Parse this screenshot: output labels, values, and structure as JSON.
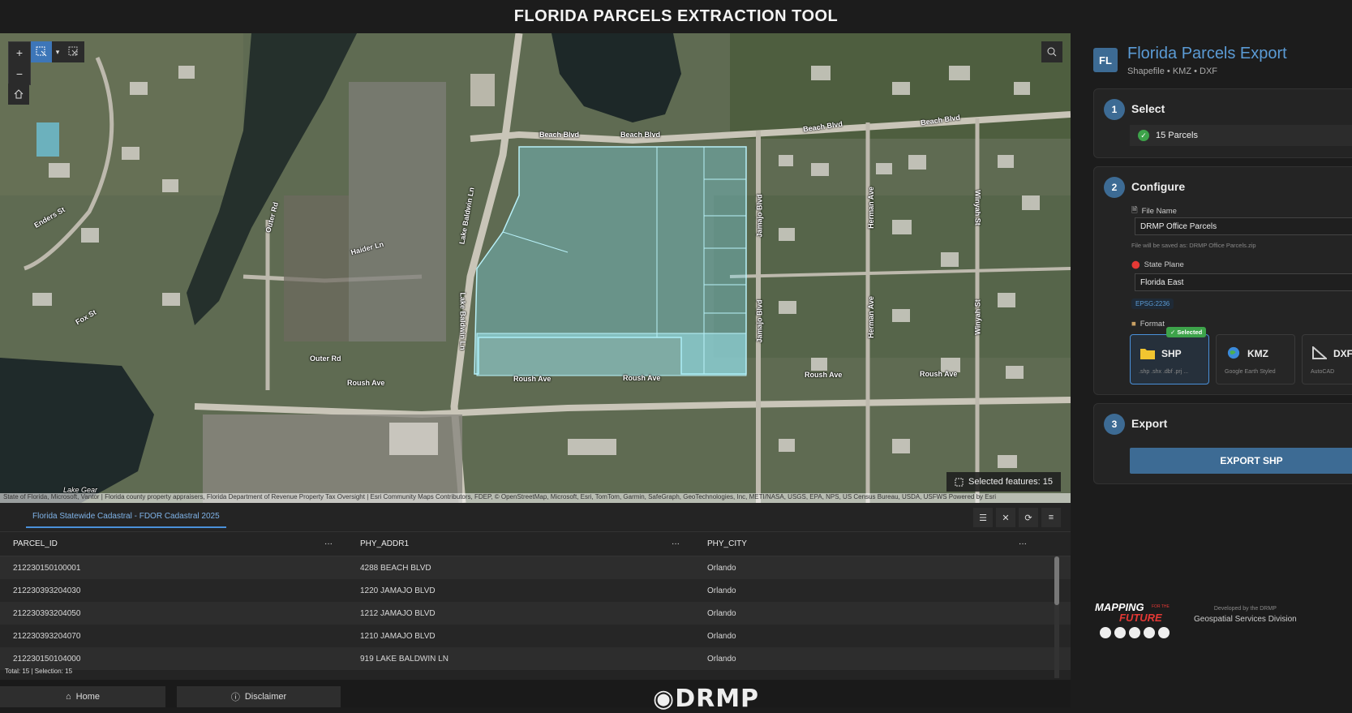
{
  "app": {
    "title": "FLORIDA PARCELS EXTRACTION TOOL"
  },
  "map": {
    "zoom_in": "+",
    "zoom_out": "−",
    "selected_label": "Selected features: 15",
    "attribution": "State of Florida, Microsoft, Vantor | Florida county property appraisers, Florida Department of Revenue Property Tax Oversight | Esri Community Maps Contributors, FDEP, © OpenStreetMap, Microsoft, Esri, TomTom, Garmin, SafeGraph, GeoTechnologies, Inc, METI/NASA, USGS, EPA, NPS, US Census Bureau, USDA, USFWS",
    "powered_by": "Powered by Esri",
    "street_labels": {
      "beach_blvd_1": "Beach Blvd",
      "beach_blvd_2": "Beach Blvd",
      "beach_blvd_3": "Beach Blvd",
      "beach_blvd_4": "Beach Blvd",
      "roush_ave_1": "Roush Ave",
      "roush_ave_2": "Roush Ave",
      "roush_ave_3": "Roush Ave",
      "roush_ave_4": "Roush Ave",
      "roush_ave_5": "Roush Ave",
      "outer_rd_1": "Outer Rd",
      "outer_rd_2": "Outer Rd",
      "lake_baldwin_1": "Lake Baldwin Ln",
      "lake_baldwin_2": "Lake Baldwin Ln",
      "jamajo_1": "Jamajo Blvd",
      "jamajo_2": "Jamajo Blvd",
      "herman_1": "Herman Ave",
      "herman_2": "Herman Ave",
      "winyah_1": "Winyah St",
      "winyah_2": "Winyah St",
      "haider": "Haider Ln",
      "enders": "Enders St",
      "fox": "Fox St",
      "lake_gear": "Lake Gear"
    }
  },
  "table": {
    "tab_label": "Florida Statewide Cadastral - FDOR Cadastral 2025",
    "columns": [
      "PARCEL_ID",
      "PHY_ADDR1",
      "PHY_CITY"
    ],
    "rows": [
      [
        "212230150100001",
        "4288 BEACH BLVD",
        "Orlando"
      ],
      [
        "212230393204030",
        "1220 JAMAJO BLVD",
        "Orlando"
      ],
      [
        "212230393204050",
        "1212 JAMAJO BLVD",
        "Orlando"
      ],
      [
        "212230393204070",
        "1210 JAMAJO BLVD",
        "Orlando"
      ],
      [
        "212230150104000",
        "919 LAKE BALDWIN LN",
        "Orlando"
      ]
    ],
    "more_icon": "···",
    "total": "Total: 15 | Selection: 15"
  },
  "footer": {
    "home_label": "Home",
    "disclaimer_label": "Disclaimer",
    "logo_text": "DRMP"
  },
  "panel": {
    "badge": "FL",
    "title": "Florida Parcels Export",
    "subtitle": "Shapefile • KMZ • DXF",
    "select": {
      "step": "1",
      "title": "Select",
      "chip": "15 Parcels"
    },
    "configure": {
      "step": "2",
      "title": "Configure",
      "file_label": "File Name",
      "file_value": "DRMP Office Parcels",
      "file_note": "File will be saved as: DRMP Office Parcels.zip",
      "plane_label": "State Plane",
      "plane_value": "Florida East",
      "epsg": "EPSG:2236",
      "format_label": "Format",
      "formats": [
        {
          "name": "SHP",
          "desc": ".shp .shx .dbf .prj ...",
          "badge": "✓ Selected"
        },
        {
          "name": "KMZ",
          "desc": "Google Earth Styled"
        },
        {
          "name": "DXF",
          "desc": "AutoCAD"
        }
      ]
    },
    "export": {
      "step": "3",
      "title": "Export",
      "button": "EXPORT SHP"
    },
    "branding": {
      "line1": "MAPPING",
      "line2": "FUTURE",
      "for_the": "FOR THE",
      "developed_by": "Developed by the DRMP",
      "division": "Geospatial Services Division"
    }
  },
  "colors": {
    "accent": "#3d6b94",
    "link": "#5b9bd5",
    "success": "#3da34a",
    "selection": "#7fe0f0"
  }
}
